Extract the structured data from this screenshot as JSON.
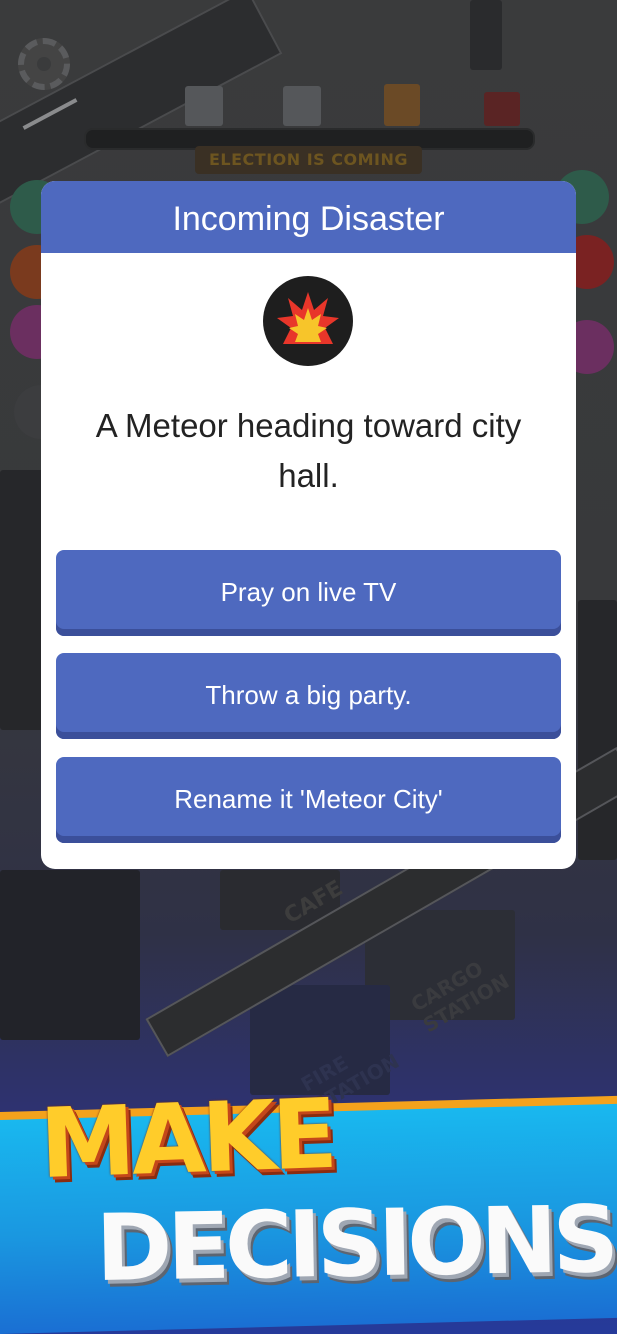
{
  "hud": {
    "settings_icon": "gear-icon",
    "election_banner": "ELECTION IS COMING"
  },
  "dialog": {
    "title": "Incoming Disaster",
    "icon": "explosion-icon",
    "message": "A Meteor heading toward city hall.",
    "choices": [
      {
        "label": "Pray on live TV"
      },
      {
        "label": "Throw a big party."
      },
      {
        "label": "Rename it 'Meteor City'"
      }
    ]
  },
  "city_labels": {
    "cafe": "CAFE",
    "cargo_station": "CARGO STATION",
    "fire_station": "FIRE STATION"
  },
  "promo": {
    "line1": "MAKE",
    "line2": "DECISIONS"
  },
  "colors": {
    "dialog_header": "#4e69bf",
    "button": "#4e69bf",
    "make_text": "#ffcc2a",
    "banner_blue": "#19b8ef"
  }
}
